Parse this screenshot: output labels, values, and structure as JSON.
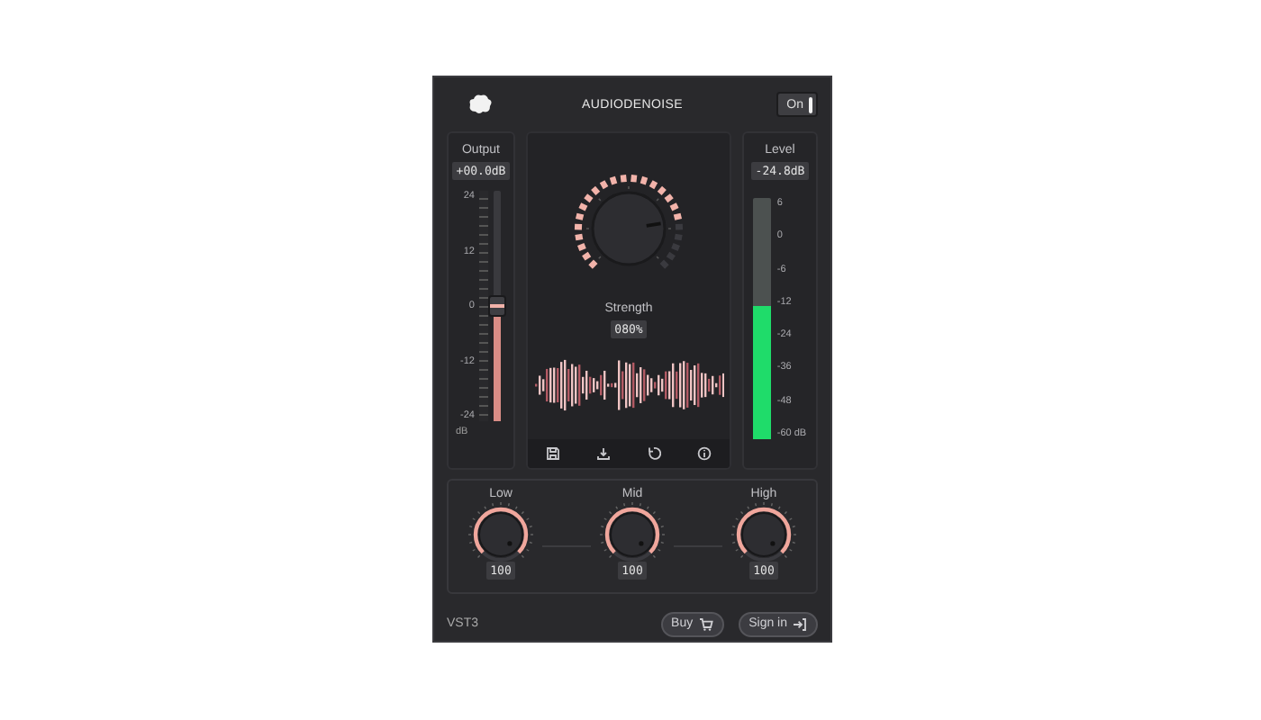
{
  "header": {
    "title": "AUDIODENOISE",
    "power": {
      "label": "On",
      "on": true
    }
  },
  "output": {
    "label": "Output",
    "value": "+00.0dB",
    "scale": [
      "24",
      "12",
      "0",
      "-12",
      "-24"
    ],
    "unit": "dB",
    "level": 0.5
  },
  "strength": {
    "label": "Strength",
    "value": "080%",
    "level": 0.8
  },
  "toolbar": [
    {
      "kind": "save"
    },
    {
      "kind": "download"
    },
    {
      "kind": "reset"
    },
    {
      "kind": "info"
    }
  ],
  "level_meter": {
    "label": "Level",
    "value": "-24.8dB",
    "scale": [
      "6",
      "0",
      "-6",
      "-12",
      "-24",
      "-36",
      "-48",
      "-60 dB"
    ],
    "level": 0.55
  },
  "bands": [
    {
      "label": "Low",
      "value": "100",
      "level": 1
    },
    {
      "label": "Mid",
      "value": "100",
      "level": 1
    },
    {
      "label": "High",
      "value": "100",
      "level": 1
    }
  ],
  "footer": {
    "format": "VST3",
    "buttons": [
      {
        "label": "Buy",
        "kind": "buy"
      },
      {
        "label": "Sign in",
        "kind": "sign-in"
      }
    ]
  }
}
